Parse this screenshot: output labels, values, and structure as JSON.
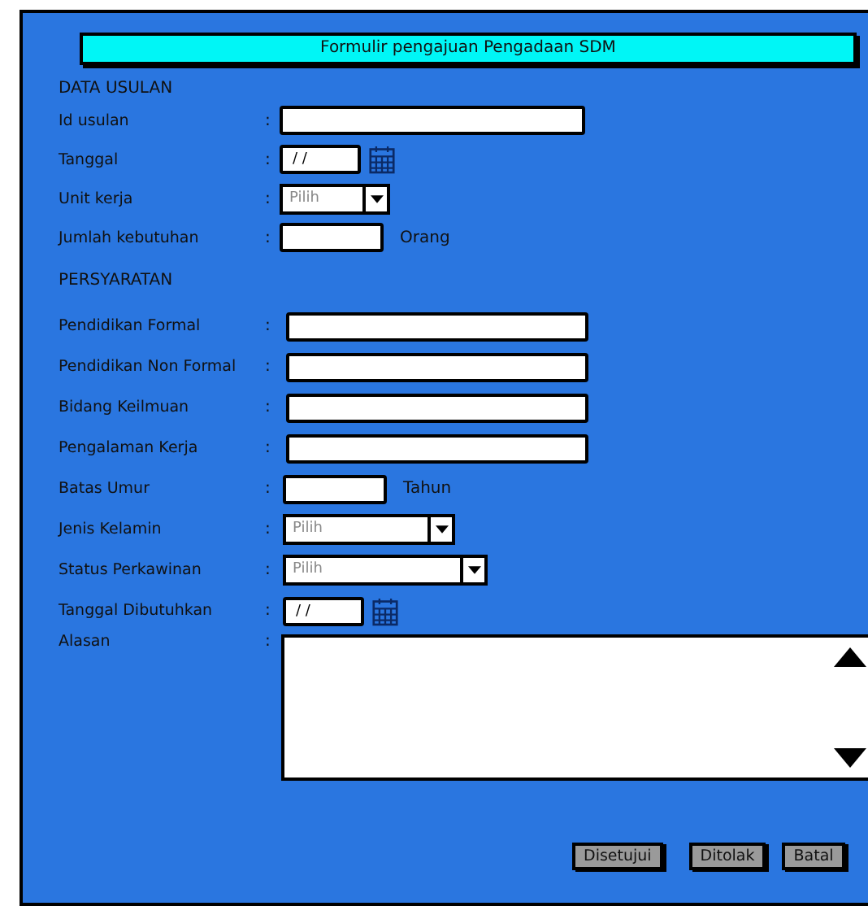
{
  "title": "Formulir pengajuan Pengadaan SDM",
  "sections": [
    {
      "heading": "DATA USULAN",
      "fields": [
        {
          "label": "Id usulan",
          "colon": ":",
          "kind": "text"
        },
        {
          "label": "Tanggal",
          "colon": ":",
          "kind": "date",
          "value": "/ /"
        },
        {
          "label": "Unit kerja",
          "colon": ":",
          "kind": "select",
          "placeholder": "Pilih"
        },
        {
          "label": "Jumlah kebutuhan",
          "colon": ":",
          "kind": "text",
          "suffix": "Orang"
        }
      ]
    },
    {
      "heading": "PERSYARATAN",
      "fields": [
        {
          "label": "Pendidikan Formal",
          "colon": ":",
          "kind": "text"
        },
        {
          "label": "Pendidikan Non Formal",
          "colon": ":",
          "kind": "text"
        },
        {
          "label": "Bidang Keilmuan",
          "colon": ":",
          "kind": "text"
        },
        {
          "label": "Pengalaman Kerja",
          "colon": ":",
          "kind": "text"
        },
        {
          "label": "Batas Umur",
          "colon": ":",
          "kind": "text",
          "suffix": "Tahun"
        },
        {
          "label": "Jenis Kelamin",
          "colon": ":",
          "kind": "select",
          "placeholder": "Pilih"
        },
        {
          "label": "Status Perkawinan",
          "colon": ":",
          "kind": "select",
          "placeholder": "Pilih"
        },
        {
          "label": "Tanggal Dibutuhkan",
          "colon": ":",
          "kind": "date",
          "value": "/ /"
        },
        {
          "label": "Alasan",
          "colon": ":",
          "kind": "textarea"
        }
      ]
    }
  ],
  "buttons": [
    "Disetujui",
    "Ditolak",
    "Batal"
  ]
}
